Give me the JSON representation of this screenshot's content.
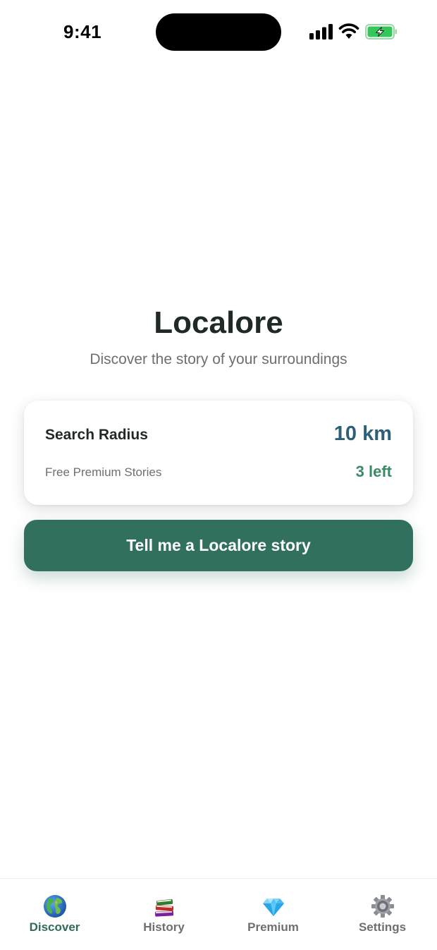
{
  "status_bar": {
    "time": "9:41",
    "icons": [
      "cellular-signal-icon",
      "wifi-icon",
      "battery-charging-icon"
    ]
  },
  "hero": {
    "title": "Localore",
    "subtitle": "Discover the story of your surroundings"
  },
  "info_card": {
    "radius_label": "Search Radius",
    "radius_value": "10 km",
    "stories_label": "Free Premium Stories",
    "stories_value": "3 left"
  },
  "cta": {
    "label": "Tell me a Localore story"
  },
  "tab_bar": {
    "active": "discover",
    "tabs": [
      {
        "id": "discover",
        "label": "Discover",
        "icon": "globe-icon"
      },
      {
        "id": "history",
        "label": "History",
        "icon": "books-icon"
      },
      {
        "id": "premium",
        "label": "Premium",
        "icon": "gem-icon"
      },
      {
        "id": "settings",
        "label": "Settings",
        "icon": "gear-icon"
      }
    ]
  },
  "colors": {
    "primary": "#31705e",
    "radius_value": "#2e5f78",
    "stories_value": "#3b8a67",
    "title": "#1f2a26",
    "muted": "#6e6e73"
  }
}
